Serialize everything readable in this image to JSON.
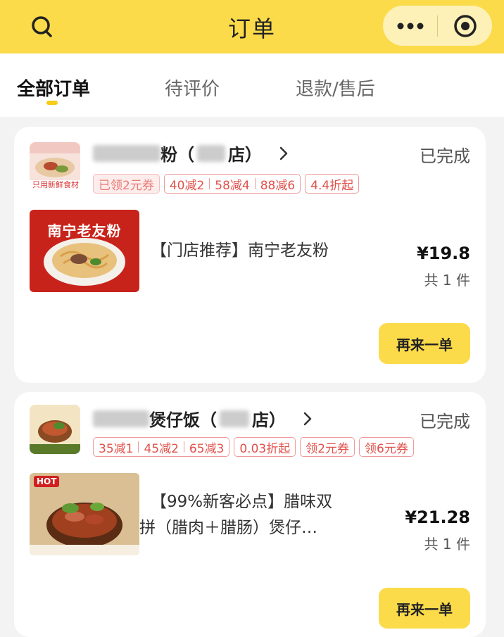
{
  "header": {
    "title": "订单",
    "accent_color": "#fbdb4a"
  },
  "tabs": [
    {
      "label": "全部订单",
      "active": true
    },
    {
      "label": "待评价",
      "active": false
    },
    {
      "label": "退款/售后",
      "active": false
    }
  ],
  "orders": [
    {
      "store_name_visible": "粉（",
      "store_name_suffix": "店）",
      "status": "已完成",
      "logo_text": "只用新鲜食材",
      "tags": [
        {
          "text": "已领2元券",
          "filled": true
        },
        {
          "parts": [
            "40减2",
            "58减4",
            "88减6"
          ]
        },
        {
          "text": "4.4折起"
        }
      ],
      "product_image_text": "南宁老友粉",
      "product_name": "【门店推荐】南宁老友粉",
      "price": "¥19.8",
      "quantity": "共 1 件",
      "reorder_label": "再来一单"
    },
    {
      "store_name_visible": "煲仔饭（",
      "store_name_suffix": "店）",
      "status": "已完成",
      "tags": [
        {
          "parts": [
            "35减1",
            "45减2",
            "65减3"
          ]
        },
        {
          "text": "0.03折起"
        },
        {
          "text": "领2元券"
        },
        {
          "text": "领6元券"
        }
      ],
      "product_image_text": "HOT",
      "product_name_line1": "【99%新客必点】腊味双",
      "product_name_line2": "拼（腊肉＋腊肠）煲仔…",
      "price": "¥21.28",
      "quantity": "共 1 件",
      "reorder_label": "再来一单"
    }
  ]
}
